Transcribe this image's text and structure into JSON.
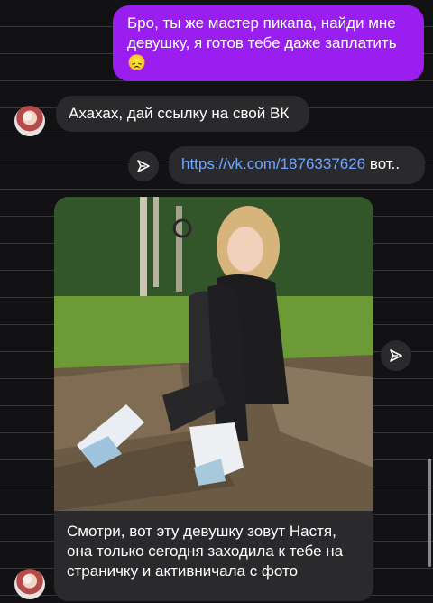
{
  "messages": {
    "out_1": {
      "text": "Бро, ты же мастер пикапа, найди мне девушку, я готов тебе даже заплатить 😞"
    },
    "in_1": {
      "text": "Ахахах, дай ссылку на свой ВК"
    },
    "out_2": {
      "link": "https://vk.com/1876337626",
      "suffix": " вот.."
    },
    "in_2": {
      "caption": "Смотри, вот эту девушку зовут Настя, она только сегодня заходила к тебе на страничку и активничала с фото"
    }
  },
  "icons": {
    "share": "paper-plane-icon",
    "avatar": "avatar"
  },
  "colors": {
    "outgoing_bubble": "#9b1ef0",
    "incoming_bubble": "#2a2a2d",
    "link": "#6fa6ff",
    "background": "#121214"
  }
}
